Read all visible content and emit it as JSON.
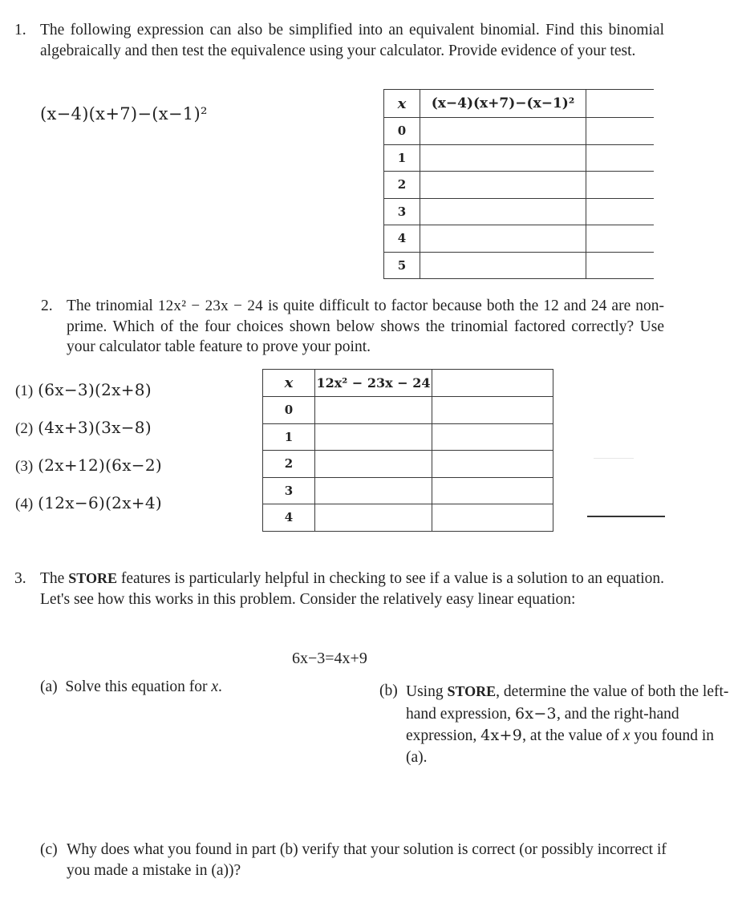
{
  "problem1": {
    "number": "1.",
    "text": "The following expression can also be simplified into an equivalent binomial. Find this binomial algebraically and then test the equivalence using your calculator. Provide evidence of your test.",
    "expression": "(x−4)(x+7)−(x−1)²",
    "table": {
      "headers": [
        "x",
        "(x−4)(x+7)−(x−1)²",
        ""
      ],
      "rows": [
        [
          "0",
          "",
          ""
        ],
        [
          "1",
          "",
          ""
        ],
        [
          "2",
          "",
          ""
        ],
        [
          "3",
          "",
          ""
        ],
        [
          "4",
          "",
          ""
        ],
        [
          "5",
          "",
          ""
        ]
      ]
    }
  },
  "problem2": {
    "number": "2.",
    "text_pre": "The trinomial ",
    "trinomial": "12x² − 23x − 24",
    "text_post": " is quite difficult to factor because both the 12 and 24 are non-prime. Which of the four choices shown below shows the trinomial factored correctly? Use your calculator table feature to prove your point.",
    "choices": [
      {
        "label": "(1)",
        "expr": "(6x−3)(2x+8)"
      },
      {
        "label": "(2)",
        "expr": "(4x+3)(3x−8)"
      },
      {
        "label": "(3)",
        "expr": "(2x+12)(6x−2)"
      },
      {
        "label": "(4)",
        "expr": "(12x−6)(2x+4)"
      }
    ],
    "table": {
      "headers": [
        "x",
        "12x² − 23x − 24",
        ""
      ],
      "rows": [
        [
          "0",
          "",
          ""
        ],
        [
          "1",
          "",
          ""
        ],
        [
          "2",
          "",
          ""
        ],
        [
          "3",
          "",
          ""
        ],
        [
          "4",
          "",
          ""
        ]
      ]
    },
    "answer_blank": ""
  },
  "problem3": {
    "number": "3.",
    "text_pre": "The ",
    "store_word": "STORE",
    "text_post": " features is particularly helpful in checking to see if a value is a solution to an equation. Let's see how this works in this problem. Consider the relatively easy linear equation:",
    "equation": "6x−3=4x+9",
    "part_a": {
      "label": "(a)",
      "text": "Solve this equation for ",
      "var": "x",
      "end": "."
    },
    "part_b": {
      "label": "(b)",
      "t1": "Using ",
      "store_word": "STORE",
      "t2": ", determine the value of both the left-hand expression, ",
      "e1": "6x−3",
      "t3": ", and the right-hand expression, ",
      "e2": "4x+9",
      "t4": ", at the value of ",
      "var": "x",
      "t5": " you found in (a)."
    },
    "part_c": {
      "label": "(c)",
      "text": "Why does what you found in part (b) verify that your solution is correct (or possibly incorrect if you made a mistake in (a))?"
    }
  }
}
